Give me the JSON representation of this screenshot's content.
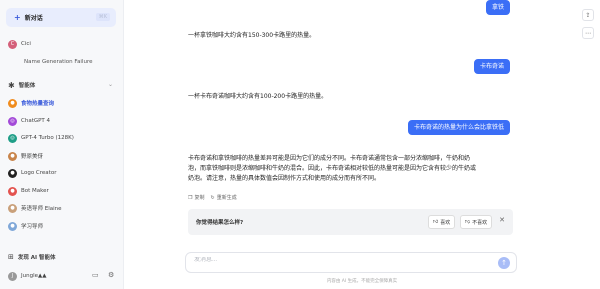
{
  "sidebar": {
    "new_chat": {
      "label": "新对话",
      "shortcut": "⌘K"
    },
    "history": [
      {
        "name": "Cici",
        "color": "#d4607a"
      }
    ],
    "history_sub": "Name Generation Failure",
    "agents_title": "智能体",
    "agents": [
      {
        "label": "食物热量查询",
        "color": "#f08c1e",
        "active": true
      },
      {
        "label": "ChatGPT 4",
        "color": "#a34ad8"
      },
      {
        "label": "GPT-4 Turbo (128K)",
        "color": "#1f9e87"
      },
      {
        "label": "野原美伢",
        "color": "#c8844a"
      },
      {
        "label": "Logo Creator",
        "color": "#222222"
      },
      {
        "label": "Bot Maker",
        "color": "#e3534f"
      },
      {
        "label": "英语导师 Elaine",
        "color": "#c9a07a"
      },
      {
        "label": "学习导师",
        "color": "#7fa7d8"
      }
    ],
    "discover": "发现 AI 智能体",
    "user_name": "Jungle▲▲"
  },
  "chat": {
    "messages": [
      {
        "role": "user",
        "text": "拿铁"
      },
      {
        "role": "ai",
        "text": "一杯拿铁咖啡大约含有150-300卡路里的热量。"
      },
      {
        "role": "user",
        "text": "卡布奇诺"
      },
      {
        "role": "ai",
        "text": "一杯卡布奇诺咖啡大约含有100-200卡路里的热量。"
      },
      {
        "role": "user",
        "text": "卡布奇诺的热量为什么会比拿铁低"
      },
      {
        "role": "ai",
        "lines": [
          "卡布奇诺和拿铁咖啡的热量差异可能是因为它们的成分不同。卡布奇诺通常包含一部分浓缩咖啡，牛奶和奶",
          "泡，而拿铁咖啡则是浓缩咖啡和牛奶的混合。因此，卡布奇诺相对较低的热量可能是因为它含有较少的牛奶或",
          "奶泡。请注意，热量的具体数值会因制作方式和使用的成分而有所不同。"
        ]
      }
    ],
    "actions": {
      "copy": "复制",
      "regenerate": "重新生成"
    },
    "feedback": {
      "question": "你觉得结果怎么样?",
      "like": "喜欢",
      "dislike": "不喜欢"
    },
    "input": {
      "placeholder": "发消息..."
    },
    "disclaimer": "内容由 AI 生成，不能完全保障真实"
  }
}
